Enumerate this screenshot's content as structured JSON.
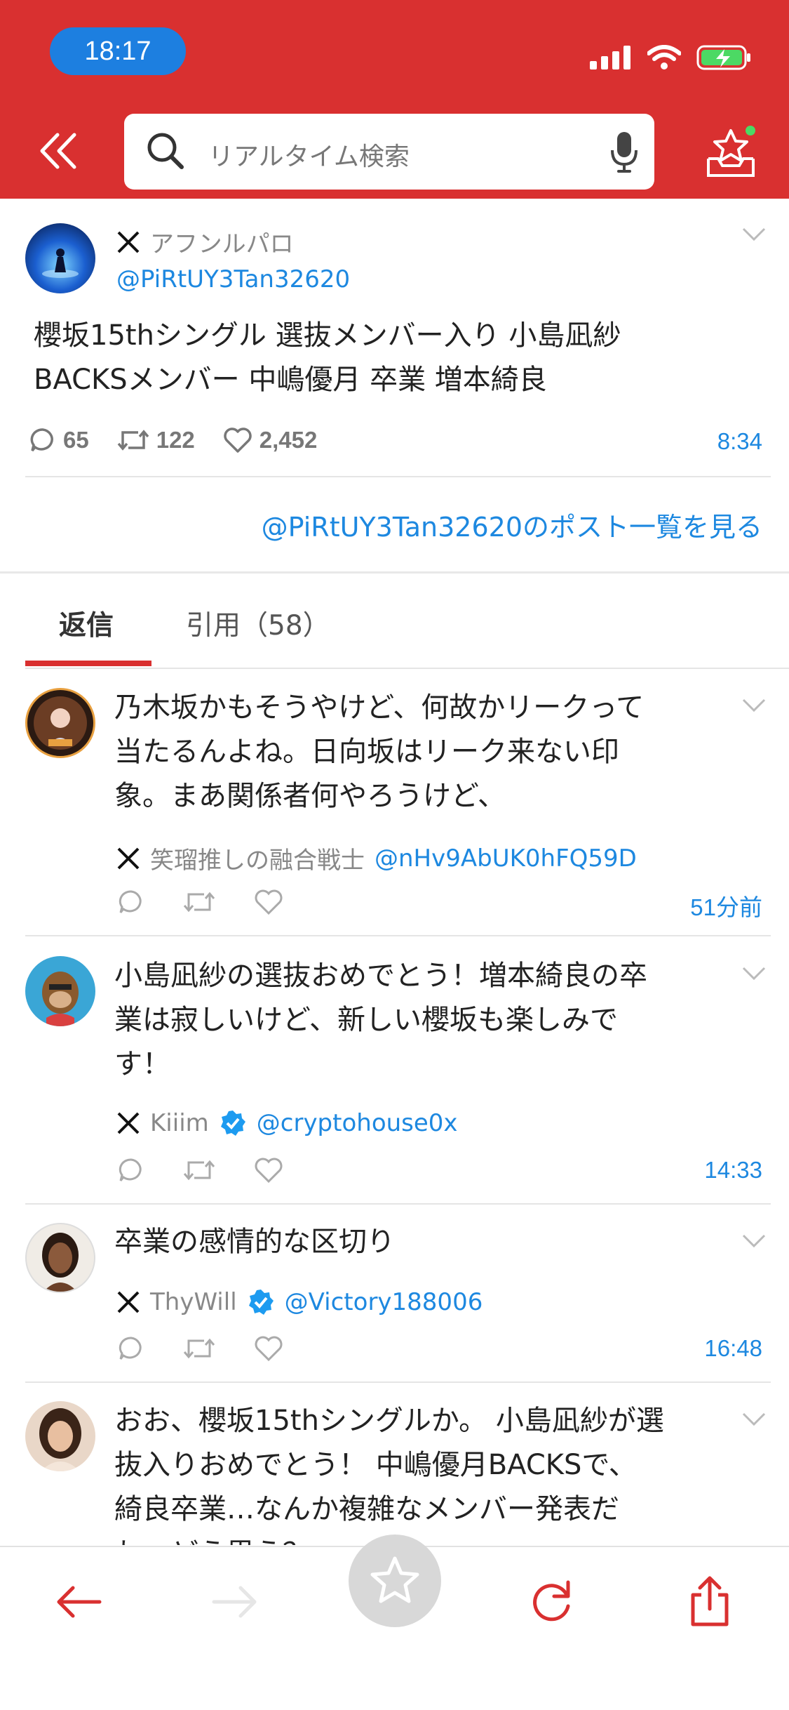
{
  "status_bar": {
    "time": "18:17"
  },
  "search": {
    "placeholder": "リアルタイム検索"
  },
  "post": {
    "author_name": "アフンルパロ",
    "handle": "@PiRtUY3Tan32620",
    "text_line1": "櫻坂15thシングル 選抜メンバー入り 小島凪紗",
    "text_line2": "BACKSメンバー 中嶋優月 卒業 増本綺良",
    "replies": "65",
    "reposts": "122",
    "likes": "2,452",
    "time": "8:34",
    "see_all_link": "@PiRtUY3Tan32620のポスト一覧を見る"
  },
  "tabs": {
    "replies": "返信",
    "quotes": "引用（58）"
  },
  "replies": [
    {
      "line1": "乃木坂かもそうやけど、何故かリークって",
      "line2": "当たるんよね。日向坂はリーク来ない印",
      "line3": "象。まあ関係者何やろうけど、",
      "name": "笑瑠推しの融合戦士",
      "handle": "@nHv9AbUK0hFQ59D",
      "time": "51分前"
    },
    {
      "line1": "小島凪紗の選抜おめでとう！増本綺良の卒",
      "line2": "業は寂しいけど、新しい櫻坂も楽しみで",
      "line3": "す！",
      "name": "Kiiim",
      "handle": "@cryptohouse0x",
      "time": "14:33"
    },
    {
      "line1": "卒業の感情的な区切り",
      "name": "ThyWill",
      "handle": "@Victory188006",
      "time": "16:48"
    },
    {
      "line1": "おお、櫻坂15thシングルか。 小島凪紗が選",
      "line2": "抜入りおめでとう！ 中嶋優月BACKSで、",
      "line3": "綺良卒業…なんか複雑なメンバー発表だ",
      "line4": "わ…どう思う？"
    }
  ],
  "colors": {
    "brand_red": "#d93030",
    "link_blue": "#1d88e0",
    "verified_blue": "#1d9bf0"
  }
}
